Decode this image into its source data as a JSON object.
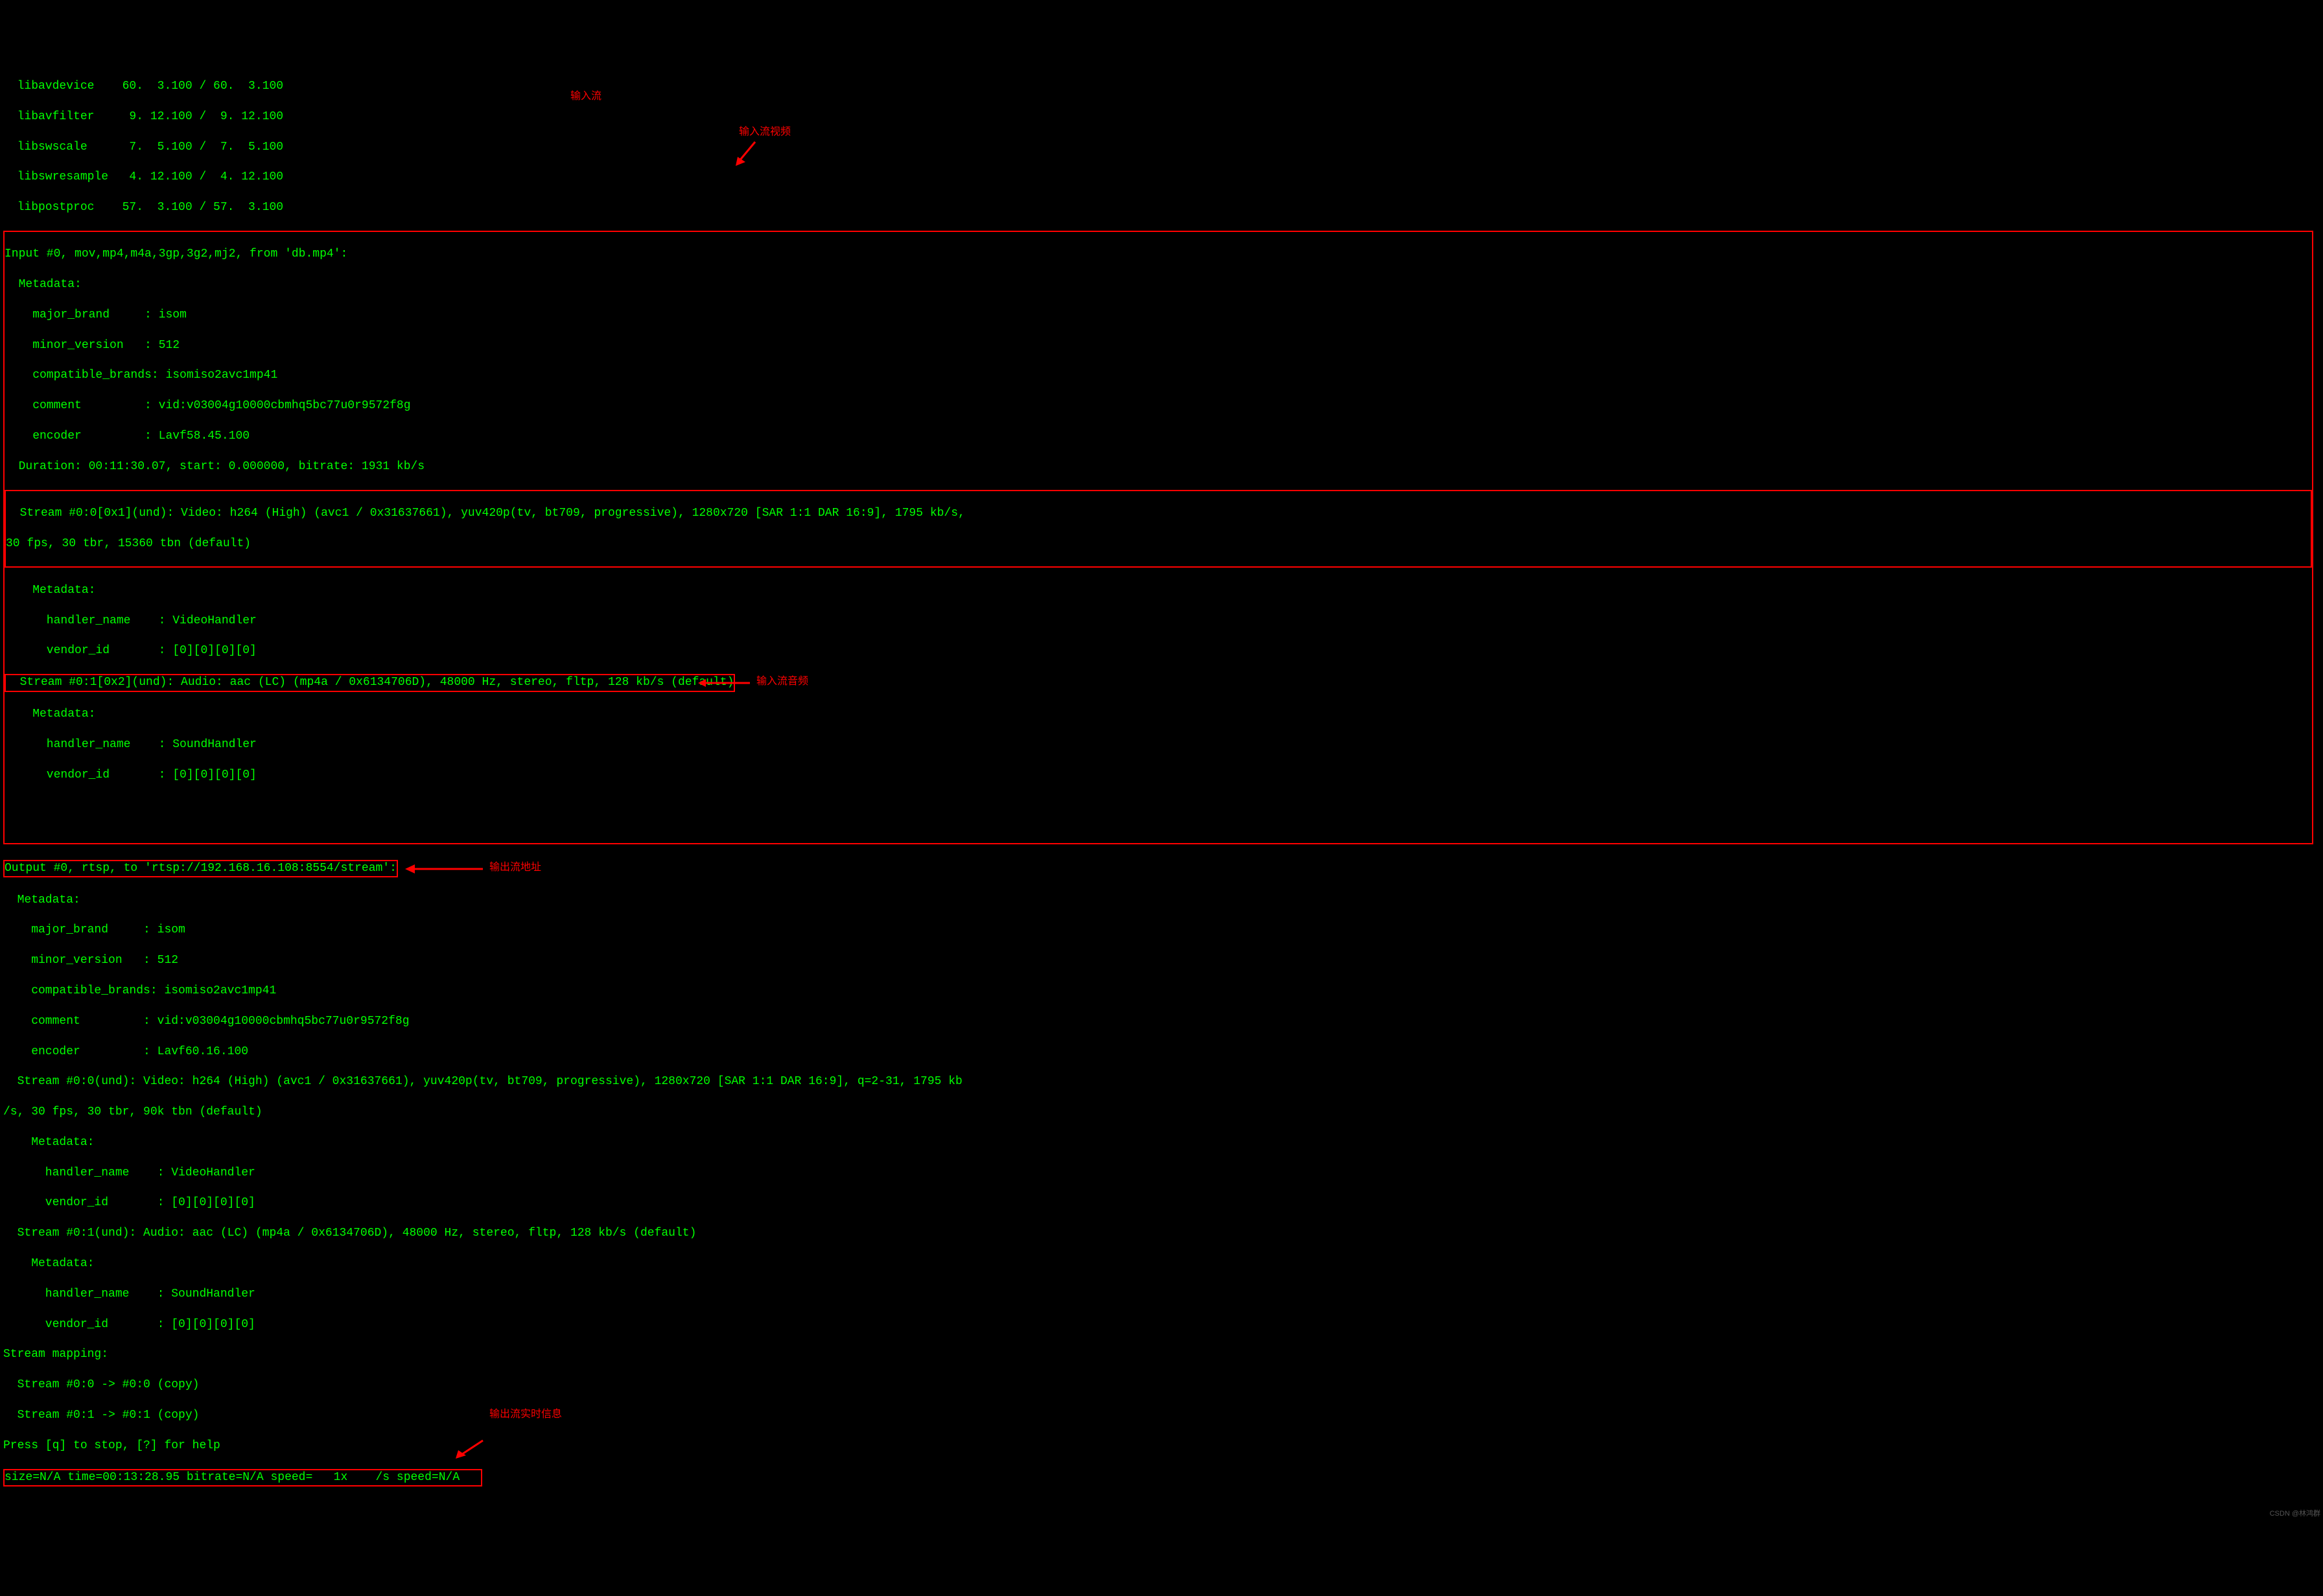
{
  "libs": {
    "line1": "  libavdevice    60.  3.100 / 60.  3.100",
    "line2": "  libavfilter     9. 12.100 /  9. 12.100",
    "line3": "  libswscale      7.  5.100 /  7.  5.100",
    "line4": "  libswresample   4. 12.100 /  4. 12.100",
    "line5": "  libpostproc    57.  3.100 / 57.  3.100"
  },
  "input": {
    "header": "Input #0, mov,mp4,m4a,3gp,3g2,mj2, from 'db.mp4':",
    "metadata_label": "  Metadata:",
    "major_brand": "    major_brand     : isom",
    "minor_version": "    minor_version   : 512",
    "compat": "    compatible_brands: isomiso2avc1mp41",
    "comment": "    comment         : vid:v03004g10000cbmhq5bc77u0r9572f8g",
    "encoder": "    encoder         : Lavf58.45.100",
    "duration": "  Duration: 00:11:30.07, start: 0.000000, bitrate: 1931 kb/s",
    "video_stream_l1": "  Stream #0:0[0x1](und): Video: h264 (High) (avc1 / 0x31637661), yuv420p(tv, bt709, progressive), 1280x720 [SAR 1:1 DAR 16:9], 1795 kb/s,",
    "video_stream_l2": "30 fps, 30 tbr, 15360 tbn (default)",
    "v_meta_label": "    Metadata:",
    "v_handler": "      handler_name    : VideoHandler",
    "v_vendor": "      vendor_id       : [0][0][0][0]",
    "audio_stream": "  Stream #0:1[0x2](und): Audio: aac (LC) (mp4a / 0x6134706D), 48000 Hz, stereo, fltp, 128 kb/s (default)",
    "a_meta_label": "    Metadata:",
    "a_handler": "      handler_name    : SoundHandler",
    "a_vendor": "      vendor_id       : [0][0][0][0]"
  },
  "output": {
    "header": "Output #0, rtsp, to 'rtsp://192.168.16.108:8554/stream':",
    "metadata_label": "  Metadata:",
    "major_brand": "    major_brand     : isom",
    "minor_version": "    minor_version   : 512",
    "compat": "    compatible_brands: isomiso2avc1mp41",
    "comment": "    comment         : vid:v03004g10000cbmhq5bc77u0r9572f8g",
    "encoder": "    encoder         : Lavf60.16.100",
    "video_stream_l1": "  Stream #0:0(und): Video: h264 (High) (avc1 / 0x31637661), yuv420p(tv, bt709, progressive), 1280x720 [SAR 1:1 DAR 16:9], q=2-31, 1795 kb",
    "video_stream_l2": "/s, 30 fps, 30 tbr, 90k tbn (default)",
    "v_meta_label": "    Metadata:",
    "v_handler": "      handler_name    : VideoHandler",
    "v_vendor": "      vendor_id       : [0][0][0][0]",
    "audio_stream": "  Stream #0:1(und): Audio: aac (LC) (mp4a / 0x6134706D), 48000 Hz, stereo, fltp, 128 kb/s (default)",
    "a_meta_label": "    Metadata:",
    "a_handler": "      handler_name    : SoundHandler",
    "a_vendor": "      vendor_id       : [0][0][0][0]"
  },
  "mapping": {
    "label": "Stream mapping:",
    "m0": "  Stream #0:0 -> #0:0 (copy)",
    "m1": "  Stream #0:1 -> #0:1 (copy)",
    "help": "Press [q] to stop, [?] for help"
  },
  "status": {
    "line": "size=N/A time=00:13:28.95 bitrate=N/A speed=   1x    /s speed=N/A   "
  },
  "labels": {
    "input_stream": "输入流",
    "input_video_stream": "输入流视频",
    "input_audio_stream": "输入流音频",
    "output_url": "输出流地址",
    "output_realtime": "输出流实时信息"
  },
  "watermark": "CSDN @林鸿群"
}
